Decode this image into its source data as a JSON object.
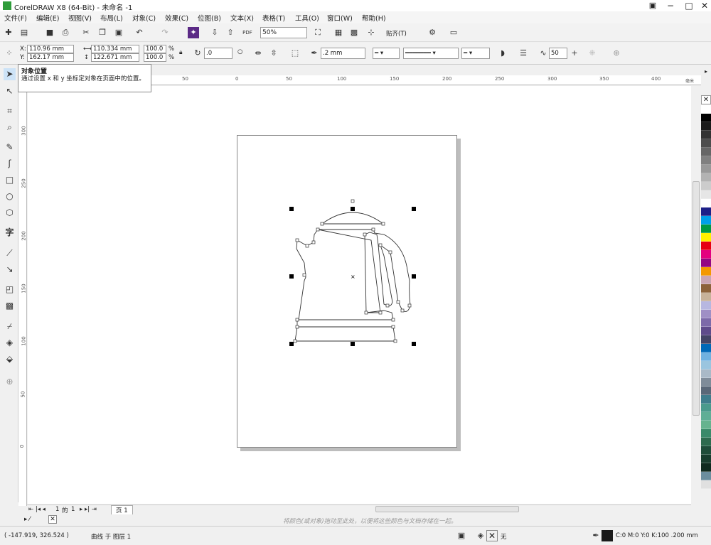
{
  "window": {
    "title": "CorelDRAW X8 (64-Bit) - 未命名 -1",
    "controls": [
      "−",
      "□",
      "✕"
    ]
  },
  "menu": [
    "文件(F)",
    "编辑(E)",
    "视图(V)",
    "布局(L)",
    "对象(C)",
    "效果(C)",
    "位图(B)",
    "文本(X)",
    "表格(T)",
    "工具(O)",
    "窗口(W)",
    "帮助(H)"
  ],
  "standard_toolbar": {
    "zoom": "50%",
    "snap_label": "贴齐(T)",
    "pdf_label": "PDF"
  },
  "property_bar": {
    "x": "110.96 mm",
    "y": "162.17 mm",
    "width": "110.334 mm",
    "height": "122.671 mm",
    "scale_w": "100.0",
    "scale_h": "100.0",
    "percent": "%",
    "rotation": ".0",
    "outline_width": ".2 mm",
    "curve_smooth": "50",
    "x_label": "X:",
    "y_label": "Y:"
  },
  "tooltip": {
    "title": "对象位置",
    "body": "通过设置 x 和 y 坐标定对象在页面中的位置。"
  },
  "rulers": {
    "units": "毫米",
    "h_ticks": [
      "50",
      "0",
      "50",
      "100",
      "150",
      "200",
      "250",
      "300",
      "350",
      "400"
    ],
    "v_ticks": [
      "300",
      "250",
      "200",
      "150",
      "100",
      "50",
      "0"
    ]
  },
  "page_nav": {
    "current": "1",
    "of": "的",
    "total": "1",
    "tab": "页 1"
  },
  "doc_palette_hint": "将颜色(或对象)拖动至此处，以便将这些颜色与文档存储在一起。",
  "status": {
    "coords": "( -147.919, 326.524 )",
    "object": "曲线 于 图层 1",
    "fill": "无",
    "outline": "C:0 M:0 Y:0 K:100  .200 mm"
  },
  "palette_colors": [
    "#ffffff",
    "#000000",
    "#1a1a1a",
    "#333333",
    "#4d4d4d",
    "#666666",
    "#808080",
    "#999999",
    "#b3b3b3",
    "#cccccc",
    "#e6e6e6",
    "#ffffff",
    "#1d2088",
    "#00a0e9",
    "#009944",
    "#fff100",
    "#e60012",
    "#e4007f",
    "#920783",
    "#f39800",
    "#c9a6b3",
    "#8c6239",
    "#c7b299",
    "#b7b7e0",
    "#9f8fc5",
    "#7d6aa9",
    "#5f4b8b",
    "#444466",
    "#0068b7",
    "#6fb1e0",
    "#9ac5df",
    "#a9b9c7",
    "#7f8c99",
    "#5a6878",
    "#3f7d8c",
    "#4a9a8c",
    "#5fae96",
    "#66b38f",
    "#3a8a6a",
    "#2e6b4f",
    "#1f4d3a",
    "#183d2e",
    "#0f2a1f",
    "#6b8e9e",
    "#e0e0e0"
  ]
}
